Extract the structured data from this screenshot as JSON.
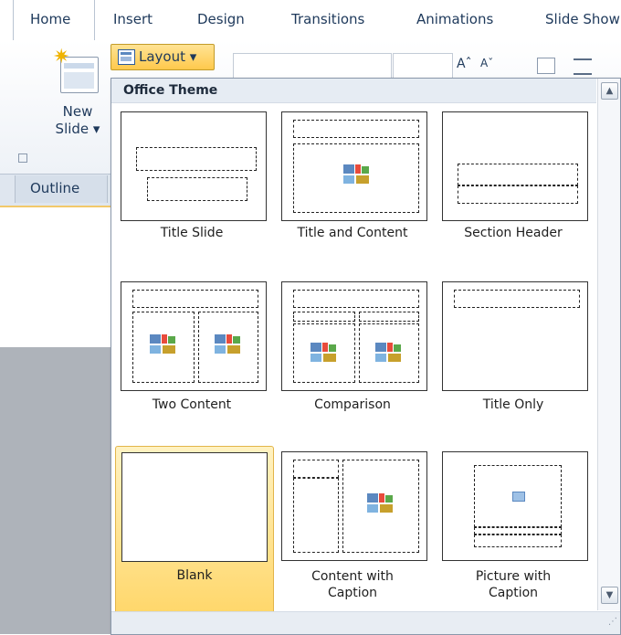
{
  "tabs": [
    "Home",
    "Insert",
    "Design",
    "Transitions",
    "Animations",
    "Slide Show"
  ],
  "ribbon": {
    "new_slide_line1": "New",
    "new_slide_line2": "Slide ▾",
    "layout_label": "Layout ▾",
    "font_grow": "Aˆ",
    "font_shrink": "Aˇ"
  },
  "outline_tab": "Outline",
  "dropdown": {
    "header": "Office Theme",
    "layouts": [
      {
        "label": "Title Slide",
        "line2": "",
        "icon": "title-slide-layout-icon"
      },
      {
        "label": "Title and Content",
        "line2": "",
        "icon": "title-and-content-layout-icon"
      },
      {
        "label": "Section Header",
        "line2": "",
        "icon": "section-header-layout-icon"
      },
      {
        "label": "Two Content",
        "line2": "",
        "icon": "two-content-layout-icon"
      },
      {
        "label": "Comparison",
        "line2": "",
        "icon": "comparison-layout-icon"
      },
      {
        "label": "Title Only",
        "line2": "",
        "icon": "title-only-layout-icon"
      },
      {
        "label": "Blank",
        "line2": "",
        "icon": "blank-layout-icon",
        "selected": true
      },
      {
        "label": "Content with",
        "line2": "Caption",
        "icon": "content-with-caption-layout-icon"
      },
      {
        "label": "Picture with",
        "line2": "Caption",
        "icon": "picture-with-caption-layout-icon"
      }
    ]
  },
  "colors": {
    "accent": "#ffd76b",
    "tab_text": "#1e395b",
    "header_bg": "#e6ecf3"
  }
}
